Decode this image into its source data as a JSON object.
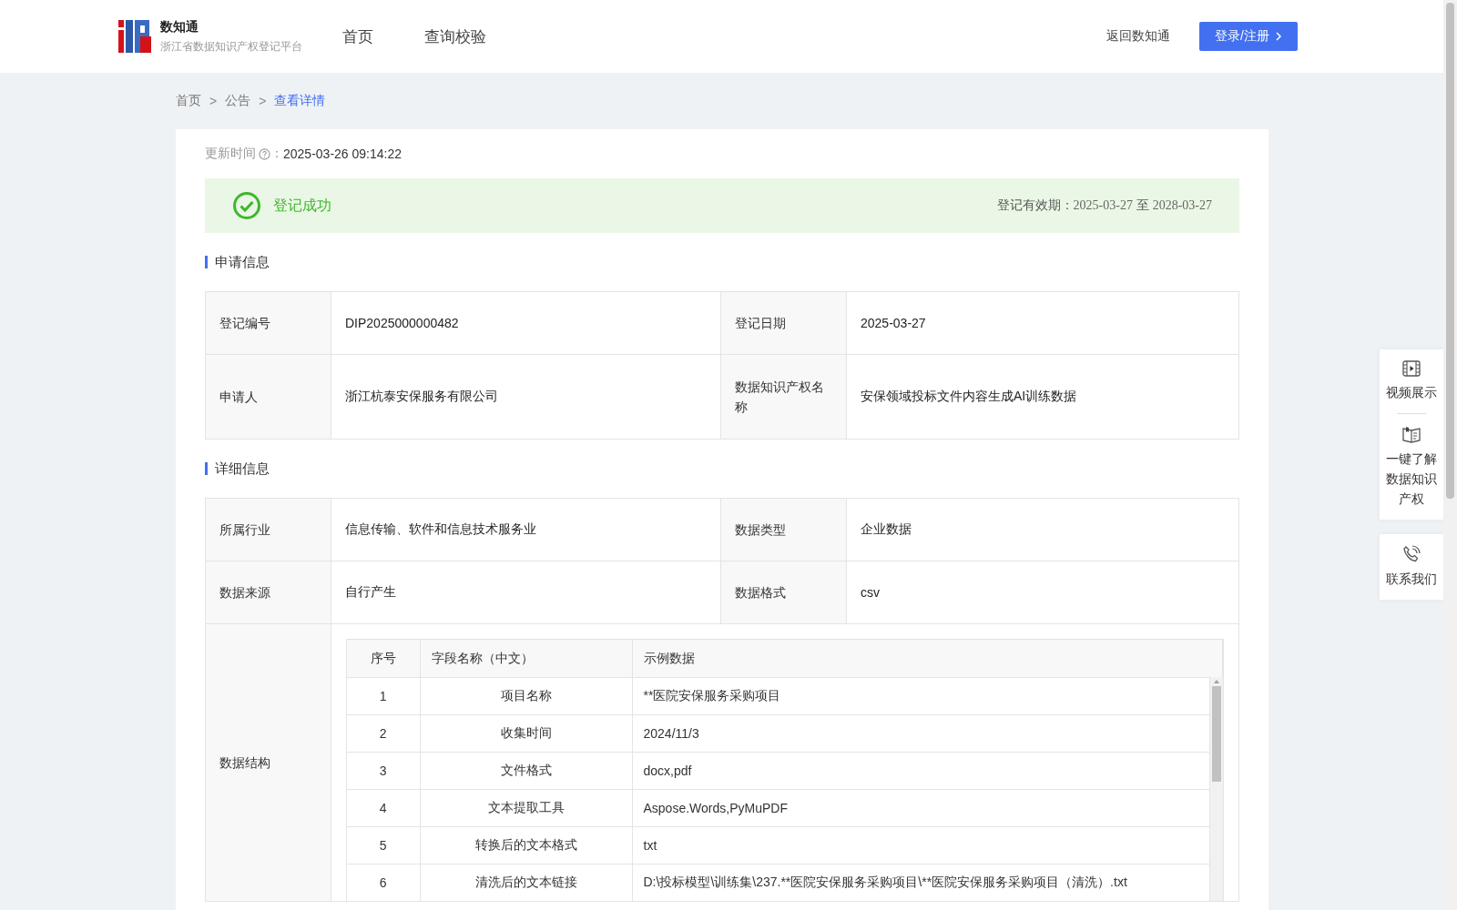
{
  "header": {
    "brand": "数知通",
    "subtitle": "浙江省数据知识产权登记平台",
    "nav": [
      {
        "label": "首页",
        "selected": false
      },
      {
        "label": "查询校验",
        "selected": false
      }
    ],
    "back_link": "返回数知通",
    "login_button": "登录/注册"
  },
  "breadcrumb": [
    {
      "label": "首页",
      "current": false
    },
    {
      "label": "公告",
      "current": false
    },
    {
      "label": "查看详情",
      "current": true
    }
  ],
  "breadcrumb_separator": ">",
  "update_time": {
    "label": "更新时间",
    "colon": "：",
    "value": "2025-03-26 09:14:22"
  },
  "status": {
    "text": "登记成功",
    "validity_label": "登记有效期：",
    "validity_from": "2025-03-27",
    "validity_to_word": "至",
    "validity_to": "2028-03-27"
  },
  "sections": [
    {
      "title": "申请信息",
      "rows": [
        [
          {
            "label": "登记编号",
            "value": "DIP2025000000482"
          },
          {
            "label": "登记日期",
            "value": "2025-03-27"
          }
        ],
        [
          {
            "label": "申请人",
            "value": "浙江杭泰安保服务有限公司"
          },
          {
            "label": "数据知识产权名称",
            "value": "安保领域投标文件内容生成AI训练数据"
          }
        ]
      ]
    },
    {
      "title": "详细信息",
      "rows": [
        [
          {
            "label": "所属行业",
            "value": "信息传输、软件和信息技术服务业"
          },
          {
            "label": "数据类型",
            "value": "企业数据"
          }
        ],
        [
          {
            "label": "数据来源",
            "value": "自行产生"
          },
          {
            "label": "数据格式",
            "value": "csv"
          }
        ]
      ],
      "structure": {
        "label": "数据结构",
        "columns": [
          "序号",
          "字段名称（中文）",
          "示例数据"
        ],
        "rows": [
          [
            "1",
            "项目名称",
            "**医院安保服务采购项目"
          ],
          [
            "2",
            "收集时间",
            "2024/11/3"
          ],
          [
            "3",
            "文件格式",
            "docx,pdf"
          ],
          [
            "4",
            "文本提取工具",
            "Aspose.Words,PyMuPDF"
          ],
          [
            "5",
            "转换后的文本格式",
            "txt"
          ],
          [
            "6",
            "清洗后的文本链接",
            "D:\\投标模型\\训练集\\237.**医院安保服务采购项目\\**医院安保服务采购项目（清洗）.txt"
          ]
        ]
      }
    }
  ],
  "float_menu": [
    {
      "kind": "video",
      "label": "视频展示"
    },
    {
      "kind": "book",
      "label": "一键了解数据知识产权"
    },
    {
      "kind": "phone",
      "label": "联系我们"
    }
  ]
}
